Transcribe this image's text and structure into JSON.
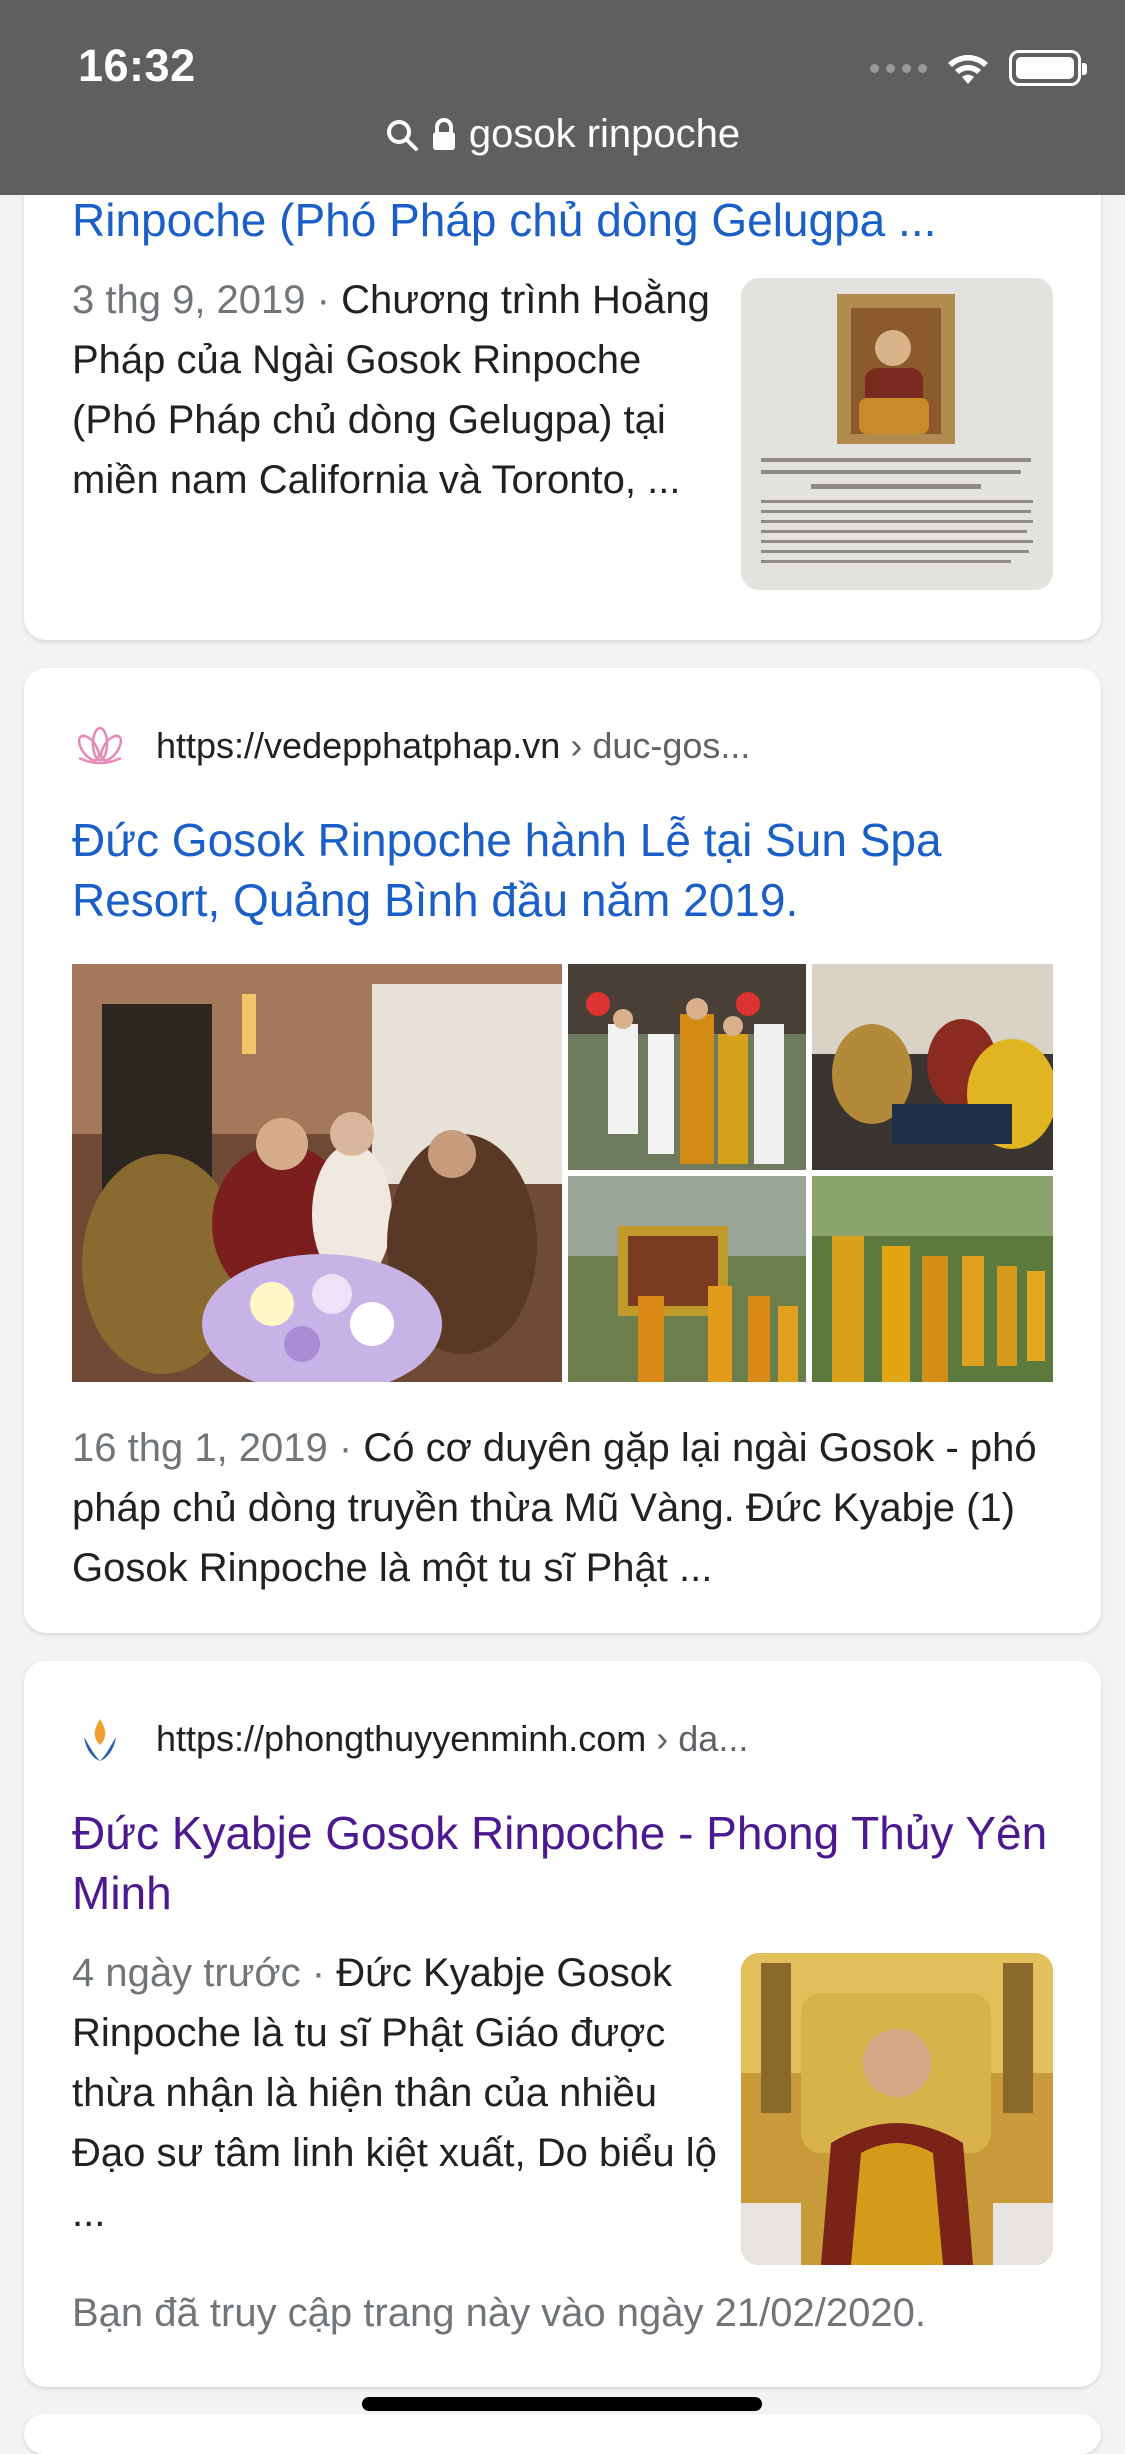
{
  "status_bar": {
    "time": "16:32"
  },
  "url_bar": {
    "query": "gosok rinpoche"
  },
  "results": [
    {
      "title": "Rinpoche (Phó Pháp chủ dòng Gelugpa ...",
      "date": "3 thg 9, 2019",
      "separator": " · ",
      "snippet": "Chương trình Hoằng Pháp của Ngài Gosok Rinpoche (Phó Pháp chủ dòng Gelugpa) tại miền nam California và Toronto, ..."
    },
    {
      "url": "https://vedepphatphap.vn",
      "crumb": " › duc-gos...",
      "title": "Đức Gosok Rinpoche hành Lễ tại Sun Spa Resort, Quảng Bình đầu năm 2019.",
      "date": "16 thg 1, 2019",
      "separator": " · ",
      "snippet": "Có cơ duyên gặp lại ngài Gosok - phó pháp chủ dòng truyền thừa Mũ Vàng. Đức Kyabje (1) Gosok Rinpoche là một tu sĩ Phật ..."
    },
    {
      "url": "https://phongthuyyenminh.com",
      "crumb": " › da...",
      "title": "Đức Kyabje Gosok Rinpoche - Phong Thủy Yên Minh",
      "date": "4 ngày trước",
      "separator": " · ",
      "snippet": "Đức Kyabje Gosok Rinpoche là tu sĩ Phật Giáo được thừa nhận là hiện thân của nhiều Đạo sư tâm linh kiệt xuất, Do biểu lộ ...",
      "visited_note": "Bạn đã truy cập trang này vào ngày 21/02/2020."
    }
  ],
  "colors": {
    "link": "#1a5fc8",
    "visited": "#4b1890",
    "topbar": "#5f5f5f"
  }
}
